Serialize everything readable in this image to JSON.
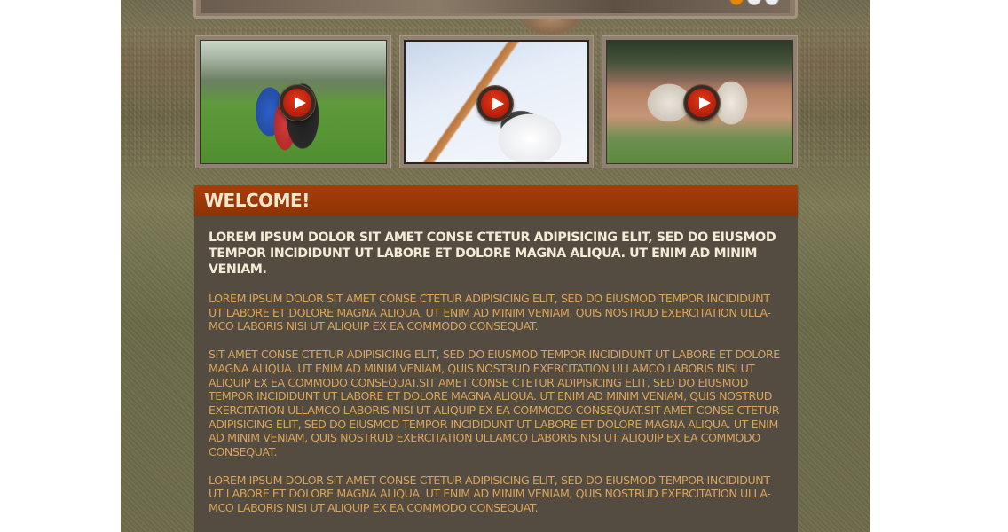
{
  "slider": {
    "dots": [
      {
        "state": "active"
      },
      {
        "state": "inactive"
      },
      {
        "state": "inactive"
      }
    ]
  },
  "videos": [
    {
      "icon": "play-icon",
      "subject": "kids-baseball-running"
    },
    {
      "icon": "play-icon",
      "subject": "batter-swinging"
    },
    {
      "icon": "play-icon",
      "subject": "pitcher-on-mound"
    }
  ],
  "welcome": {
    "title": "WELCOME!",
    "lead": "LOREM IPSUM DOLOR SIT AMET CONSE CTETUR ADIPISICING ELIT, SED DO EIUSMOD TEMPOR INCIDIDUNT UT LABORE ET DOLORE MAGNA ALIQUA. UT ENIM AD MINIM VENIAM.",
    "paragraphs": [
      "LOREM IPSUM DOLOR SIT AMET CONSE CTETUR ADIPISICING ELIT, SED DO EIUSMOD TEMPOR INCIDIDUNT UT LABORE ET DOLORE MAGNA ALIQUA. UT ENIM AD MINIM VENIAM, QUIS NOSTRUD EXERCITATION ULLA-MCO LABORIS NISI UT ALIQUIP EX EA COMMODO CONSEQUAT.",
      "SIT AMET CONSE CTETUR ADIPISICING ELIT, SED DO EIUSMOD TEMPOR INCIDIDUNT UT LABORE ET DOLORE MAGNA ALIQUA. UT ENIM AD MINIM VENIAM, QUIS NOSTRUD EXERCITATION ULLAMCO LABORIS NISI UT ALIQUIP EX EA COMMODO CONSEQUAT.SIT AMET CONSE CTETUR ADIPISICING ELIT, SED DO EIUSMOD TEMPOR INCIDIDUNT UT LABORE ET DOLORE MAGNA ALIQUA. UT ENIM AD MINIM VENIAM, QUIS NOSTRUD EXERCITATION ULLAMCO LABORIS NISI UT ALIQUIP EX EA COMMODO CONSEQUAT.SIT AMET CONSE CTETUR ADIPISICING ELIT, SED DO EIUSMOD TEMPOR INCIDIDUNT UT LABORE ET DOLORE MAGNA ALIQUA. UT ENIM AD MINIM VENIAM, QUIS NOSTRUD EXERCITATION ULLAMCO LABORIS NISI UT ALIQUIP EX EA COMMODO CONSEQUAT.",
      "LOREM IPSUM DOLOR SIT AMET CONSE CTETUR ADIPISICING ELIT, SED DO EIUSMOD TEMPOR INCIDIDUNT UT LABORE ET DOLORE MAGNA ALIQUA. UT ENIM AD MINIM VENIAM, QUIS NOSTRUD EXERCITATION ULLA-MCO LABORIS NISI UT ALIQUIP EX EA COMMODO CONSEQUAT."
    ]
  },
  "colors": {
    "accent": "#e08a10",
    "header_bar": "#9a3807",
    "panel_bg": "#544b41",
    "lead_text": "#f4ead6",
    "body_text": "#d9a55c",
    "play_button": "#c4260e"
  }
}
